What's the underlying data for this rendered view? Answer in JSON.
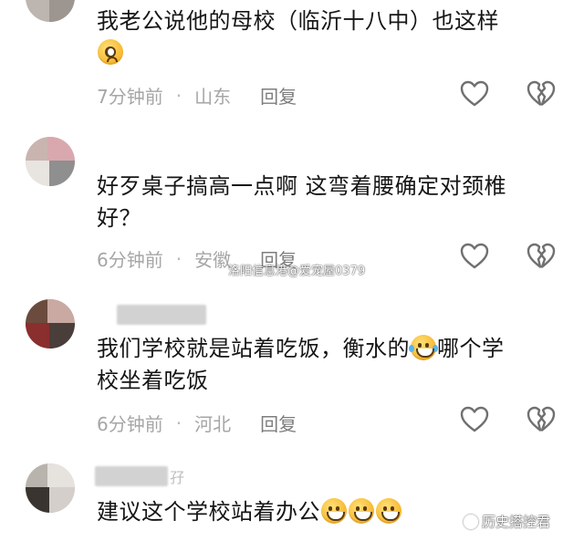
{
  "comments": [
    {
      "text": "我老公说他的母校（临沂十八中）也这样",
      "emoji": "pleading-face",
      "time": "7分钟前",
      "location": "山东",
      "reply": "回复"
    },
    {
      "text_line1": "好歹桌子搞高一点啊  这弯着腰确定对颈椎",
      "text_line2": "好？",
      "time": "6分钟前",
      "location": "安徽",
      "reply": "回复"
    },
    {
      "username_tail": "",
      "text_part1": "我们学校就是站着吃饭，衡水的",
      "emoji": "laughing-crying-face",
      "text_part2": "哪个学",
      "text_line2": "校坐着吃饭",
      "time": "6分钟前",
      "location": "河北",
      "reply": "回复"
    },
    {
      "username_tail": "孖",
      "text": "建议这个学校站着办公",
      "emojis": [
        "grinning-face",
        "grinning-face",
        "grinning-face"
      ]
    }
  ],
  "watermarks": {
    "center": "洛阳信息港@爱宠屋0379",
    "corner": "历史搭控君"
  },
  "colors": {
    "text": "#161616",
    "meta": "#a6a6a6",
    "icon": "#707070"
  },
  "icons": [
    "like-heart-icon",
    "dislike-broken-heart-icon"
  ]
}
